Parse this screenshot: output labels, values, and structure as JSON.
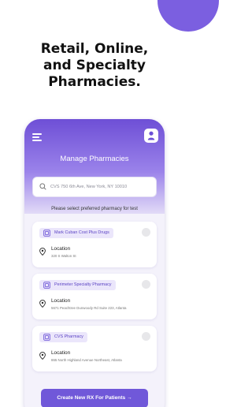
{
  "headline": "Retail, Online,\nand Specialty\nPharmacies.",
  "colors": {
    "accent": "#7b5fe0",
    "badge_bg": "#ebe6fb",
    "badge_text": "#5b43c4"
  },
  "app": {
    "menu_icon": "hamburger-menu-icon",
    "profile_icon": "user-icon",
    "title": "Manage Pharmacies",
    "search": {
      "icon": "search-icon",
      "placeholder": "CVS 750 6th Ave, New York, NY 10010"
    },
    "instruction": "Please select preferred pharmacy for test",
    "pharmacies": [
      {
        "name": "Mark Cuban Cost Plus Drugs",
        "location_label": "Location",
        "address": "320 S Walton St",
        "selected": false
      },
      {
        "name": "Perimeter Specialty Pharmacy",
        "location_label": "Location",
        "address": "5671 Peachtree Dunwoody Rd Suite 223, Atlanta",
        "selected": false
      },
      {
        "name": "CVS Pharmacy",
        "location_label": "Location",
        "address": "865 North Highland Avenue Northeast, Atlanta",
        "selected": false
      }
    ],
    "cta_label": "Create New RX For Patients →"
  }
}
